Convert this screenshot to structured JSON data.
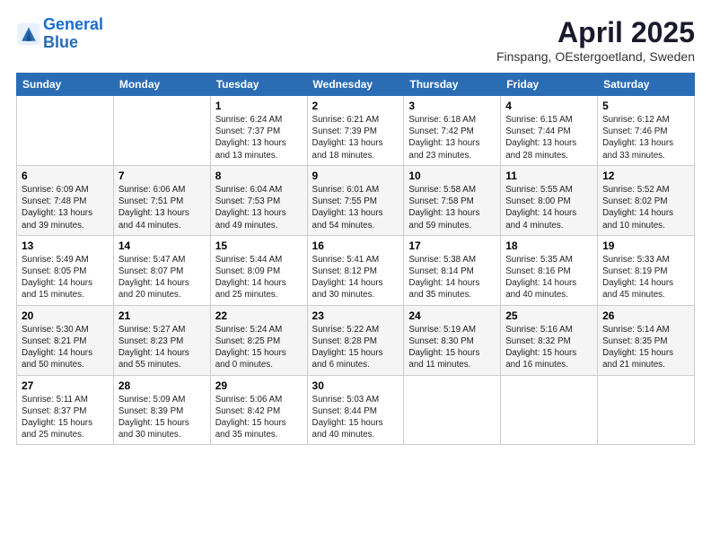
{
  "header": {
    "logo_line1": "General",
    "logo_line2": "Blue",
    "month_title": "April 2025",
    "location": "Finspang, OEstergoetland, Sweden"
  },
  "days_of_week": [
    "Sunday",
    "Monday",
    "Tuesday",
    "Wednesday",
    "Thursday",
    "Friday",
    "Saturday"
  ],
  "weeks": [
    [
      {
        "day": "",
        "info": ""
      },
      {
        "day": "",
        "info": ""
      },
      {
        "day": "1",
        "info": "Sunrise: 6:24 AM\nSunset: 7:37 PM\nDaylight: 13 hours and 13 minutes."
      },
      {
        "day": "2",
        "info": "Sunrise: 6:21 AM\nSunset: 7:39 PM\nDaylight: 13 hours and 18 minutes."
      },
      {
        "day": "3",
        "info": "Sunrise: 6:18 AM\nSunset: 7:42 PM\nDaylight: 13 hours and 23 minutes."
      },
      {
        "day": "4",
        "info": "Sunrise: 6:15 AM\nSunset: 7:44 PM\nDaylight: 13 hours and 28 minutes."
      },
      {
        "day": "5",
        "info": "Sunrise: 6:12 AM\nSunset: 7:46 PM\nDaylight: 13 hours and 33 minutes."
      }
    ],
    [
      {
        "day": "6",
        "info": "Sunrise: 6:09 AM\nSunset: 7:48 PM\nDaylight: 13 hours and 39 minutes."
      },
      {
        "day": "7",
        "info": "Sunrise: 6:06 AM\nSunset: 7:51 PM\nDaylight: 13 hours and 44 minutes."
      },
      {
        "day": "8",
        "info": "Sunrise: 6:04 AM\nSunset: 7:53 PM\nDaylight: 13 hours and 49 minutes."
      },
      {
        "day": "9",
        "info": "Sunrise: 6:01 AM\nSunset: 7:55 PM\nDaylight: 13 hours and 54 minutes."
      },
      {
        "day": "10",
        "info": "Sunrise: 5:58 AM\nSunset: 7:58 PM\nDaylight: 13 hours and 59 minutes."
      },
      {
        "day": "11",
        "info": "Sunrise: 5:55 AM\nSunset: 8:00 PM\nDaylight: 14 hours and 4 minutes."
      },
      {
        "day": "12",
        "info": "Sunrise: 5:52 AM\nSunset: 8:02 PM\nDaylight: 14 hours and 10 minutes."
      }
    ],
    [
      {
        "day": "13",
        "info": "Sunrise: 5:49 AM\nSunset: 8:05 PM\nDaylight: 14 hours and 15 minutes."
      },
      {
        "day": "14",
        "info": "Sunrise: 5:47 AM\nSunset: 8:07 PM\nDaylight: 14 hours and 20 minutes."
      },
      {
        "day": "15",
        "info": "Sunrise: 5:44 AM\nSunset: 8:09 PM\nDaylight: 14 hours and 25 minutes."
      },
      {
        "day": "16",
        "info": "Sunrise: 5:41 AM\nSunset: 8:12 PM\nDaylight: 14 hours and 30 minutes."
      },
      {
        "day": "17",
        "info": "Sunrise: 5:38 AM\nSunset: 8:14 PM\nDaylight: 14 hours and 35 minutes."
      },
      {
        "day": "18",
        "info": "Sunrise: 5:35 AM\nSunset: 8:16 PM\nDaylight: 14 hours and 40 minutes."
      },
      {
        "day": "19",
        "info": "Sunrise: 5:33 AM\nSunset: 8:19 PM\nDaylight: 14 hours and 45 minutes."
      }
    ],
    [
      {
        "day": "20",
        "info": "Sunrise: 5:30 AM\nSunset: 8:21 PM\nDaylight: 14 hours and 50 minutes."
      },
      {
        "day": "21",
        "info": "Sunrise: 5:27 AM\nSunset: 8:23 PM\nDaylight: 14 hours and 55 minutes."
      },
      {
        "day": "22",
        "info": "Sunrise: 5:24 AM\nSunset: 8:25 PM\nDaylight: 15 hours and 0 minutes."
      },
      {
        "day": "23",
        "info": "Sunrise: 5:22 AM\nSunset: 8:28 PM\nDaylight: 15 hours and 6 minutes."
      },
      {
        "day": "24",
        "info": "Sunrise: 5:19 AM\nSunset: 8:30 PM\nDaylight: 15 hours and 11 minutes."
      },
      {
        "day": "25",
        "info": "Sunrise: 5:16 AM\nSunset: 8:32 PM\nDaylight: 15 hours and 16 minutes."
      },
      {
        "day": "26",
        "info": "Sunrise: 5:14 AM\nSunset: 8:35 PM\nDaylight: 15 hours and 21 minutes."
      }
    ],
    [
      {
        "day": "27",
        "info": "Sunrise: 5:11 AM\nSunset: 8:37 PM\nDaylight: 15 hours and 25 minutes."
      },
      {
        "day": "28",
        "info": "Sunrise: 5:09 AM\nSunset: 8:39 PM\nDaylight: 15 hours and 30 minutes."
      },
      {
        "day": "29",
        "info": "Sunrise: 5:06 AM\nSunset: 8:42 PM\nDaylight: 15 hours and 35 minutes."
      },
      {
        "day": "30",
        "info": "Sunrise: 5:03 AM\nSunset: 8:44 PM\nDaylight: 15 hours and 40 minutes."
      },
      {
        "day": "",
        "info": ""
      },
      {
        "day": "",
        "info": ""
      },
      {
        "day": "",
        "info": ""
      }
    ]
  ]
}
